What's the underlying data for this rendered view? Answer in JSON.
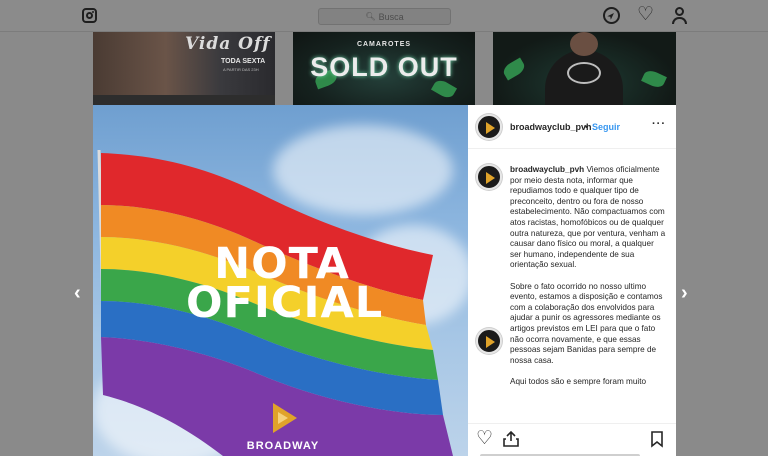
{
  "nav": {
    "search_placeholder": "Busca",
    "icons": [
      "instagram-logo-icon",
      "search-icon",
      "compass-icon",
      "heart-icon",
      "profile-icon"
    ]
  },
  "background_posts": [
    {
      "title": "Vida Off",
      "subtitle": "TODA SEXTA",
      "fine_print": "A PARTIR DAS 23H"
    },
    {
      "title": "SOLD OUT",
      "subtitle": "CAMAROTES"
    },
    {
      "title": ""
    }
  ],
  "post": {
    "image_text": {
      "headline_line1": "NOTA",
      "headline_line2": "OFICIAL",
      "brand": "BROADWAY"
    },
    "username": "broadwayclub_pvh",
    "separator": "•",
    "follow_label": "Seguir",
    "more_label": "···",
    "caption": {
      "username": "broadwayclub_pvh",
      "paragraph1": "Viemos oficialmente por meio desta nota, informar que repudiamos todo e qualquer tipo de preconceito, dentro ou fora de nosso estabelecimento. Não compactuamos com atos racistas, homofóbicos ou de qualquer outra natureza, que por ventura, venham a causar dano físico ou moral, a qualquer ser humano, independente de sua orientação sexual.",
      "paragraph2": "Sobre o fato ocorrido no nosso ultimo evento, estamos a disposição e contamos com a colaboração dos envolvidos para ajudar a punir os agressores mediante os artigos previstos em LEI para que o fato não ocorra novamente, e que essas pessoas sejam Banidas para sempre de nossa casa.",
      "paragraph3": "Aqui todos são e sempre foram muito"
    }
  },
  "colors": {
    "overlay": "#8a8a8a",
    "link": "#3897f0",
    "text": "#262626",
    "brand_gold": "#e0a32a"
  }
}
